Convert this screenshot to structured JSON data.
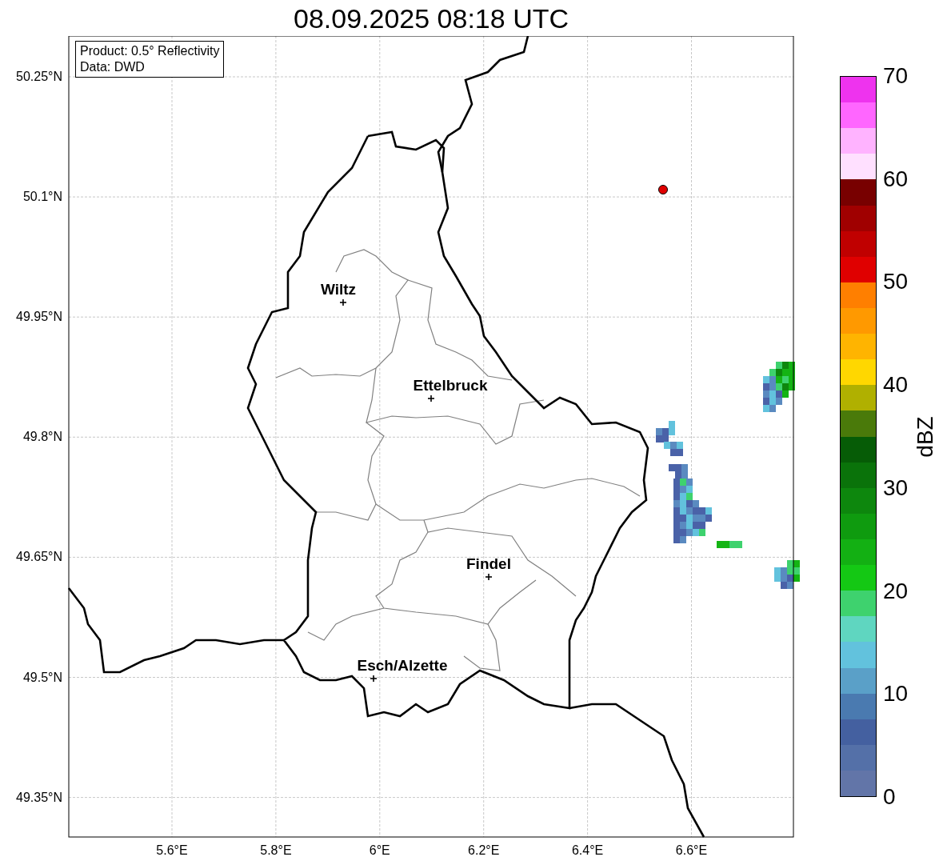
{
  "title": "08.09.2025 08:18 UTC",
  "map": {
    "info": [
      "Product: 0.5° Reflectivity",
      "Data: DWD"
    ],
    "lat_labels": [
      "50.25°N",
      "50.1°N",
      "49.95°N",
      "49.8°N",
      "49.65°N",
      "49.5°N",
      "49.35°N"
    ],
    "lon_labels": [
      "5.6°E",
      "5.8°E",
      "6°E",
      "6.2°E",
      "6.4°E",
      "6.6°E"
    ],
    "places": [
      {
        "name": "Wiltz"
      },
      {
        "name": "Ettelbruck"
      },
      {
        "name": "Findel"
      },
      {
        "name": "Esch/Alzette"
      }
    ]
  },
  "colorbar": {
    "label": "dBZ",
    "ticks": [
      "70",
      "60",
      "50",
      "40",
      "30",
      "20",
      "10",
      "0"
    ],
    "bins": [
      {
        "color": "#ee33ee"
      },
      {
        "color": "#ff66ff"
      },
      {
        "color": "#ffb3ff"
      },
      {
        "color": "#ffe0ff"
      },
      {
        "color": "#780000"
      },
      {
        "color": "#a00000"
      },
      {
        "color": "#c00000"
      },
      {
        "color": "#e00000"
      },
      {
        "color": "#ff7f00"
      },
      {
        "color": "#ff9900"
      },
      {
        "color": "#ffb400"
      },
      {
        "color": "#ffd700"
      },
      {
        "color": "#b0b000"
      },
      {
        "color": "#4a7a0a"
      },
      {
        "color": "#065c06"
      },
      {
        "color": "#0a730a"
      },
      {
        "color": "#0d870d"
      },
      {
        "color": "#0f9b0f"
      },
      {
        "color": "#13b013"
      },
      {
        "color": "#14c814"
      },
      {
        "color": "#3ed26e"
      },
      {
        "color": "#5fd6c0"
      },
      {
        "color": "#62c2dd"
      },
      {
        "color": "#5aa0c8"
      },
      {
        "color": "#4a7ab0"
      },
      {
        "color": "#4460a0"
      },
      {
        "color": "#5470a8"
      },
      {
        "color": "#6275a8"
      }
    ]
  }
}
